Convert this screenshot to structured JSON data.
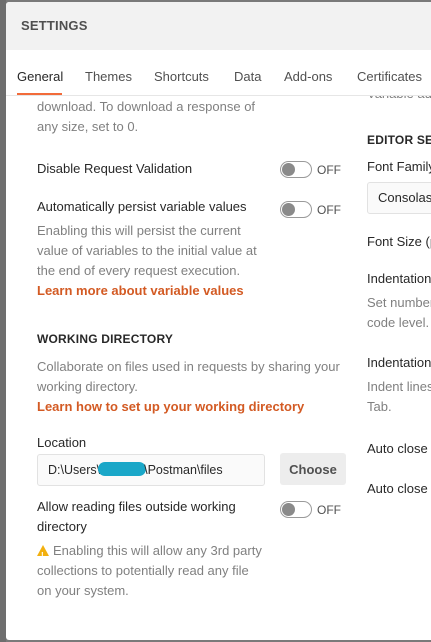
{
  "modal": {
    "title": "SETTINGS"
  },
  "tabs": [
    {
      "label": "General"
    },
    {
      "label": "Themes"
    },
    {
      "label": "Shortcuts"
    },
    {
      "label": "Data"
    },
    {
      "label": "Add-ons"
    },
    {
      "label": "Certificates"
    }
  ],
  "general": {
    "top_desc_1": "download. To download a response of",
    "top_desc_2": "any size, set to 0.",
    "disable_validation": {
      "label": "Disable Request Validation",
      "state": "OFF"
    },
    "persist_vars": {
      "label": "Automatically persist variable values",
      "state": "OFF",
      "desc_1": "Enabling this will persist the current",
      "desc_2": "value of variables to the initial value at",
      "desc_3": "the end of every request execution.",
      "link": "Learn more about variable values"
    },
    "working_dir": {
      "title": "WORKING DIRECTORY",
      "desc_1": "Collaborate on files used in requests by sharing your",
      "desc_2": "working directory.",
      "link": "Learn how to set up your working directory",
      "location_label": "Location",
      "path_prefix": "D:\\Users\\",
      "path_suffix": "\\Postman\\files",
      "choose_label": "Choose",
      "allow_outside": {
        "label_1": "Allow reading files outside working",
        "label_2": "directory",
        "state": "OFF",
        "warn_1": "Enabling this will allow any 3rd party",
        "warn_2": "collections to potentially read any file",
        "warn_3": "on your system."
      }
    }
  },
  "editor": {
    "top_cut": "Variable au",
    "title": "EDITOR SET",
    "font_family_label": "Font Family",
    "font_family_value": "Consolas",
    "font_size_label": "Font Size (p",
    "indentation_1_label": "Indentation",
    "indentation_1_desc_1": "Set number",
    "indentation_1_desc_2": "code level.",
    "indentation_2_label": "Indentation",
    "indentation_2_desc_1": "Indent lines",
    "indentation_2_desc_2": "Tab.",
    "auto_close_1": "Auto close",
    "auto_close_2": "Auto close"
  },
  "colors": {
    "accent": "#f26b3a",
    "link": "#d35a23",
    "redaction": "#1aa7c8",
    "warning": "#f2b00f"
  },
  "icons": [
    "warning-icon"
  ]
}
